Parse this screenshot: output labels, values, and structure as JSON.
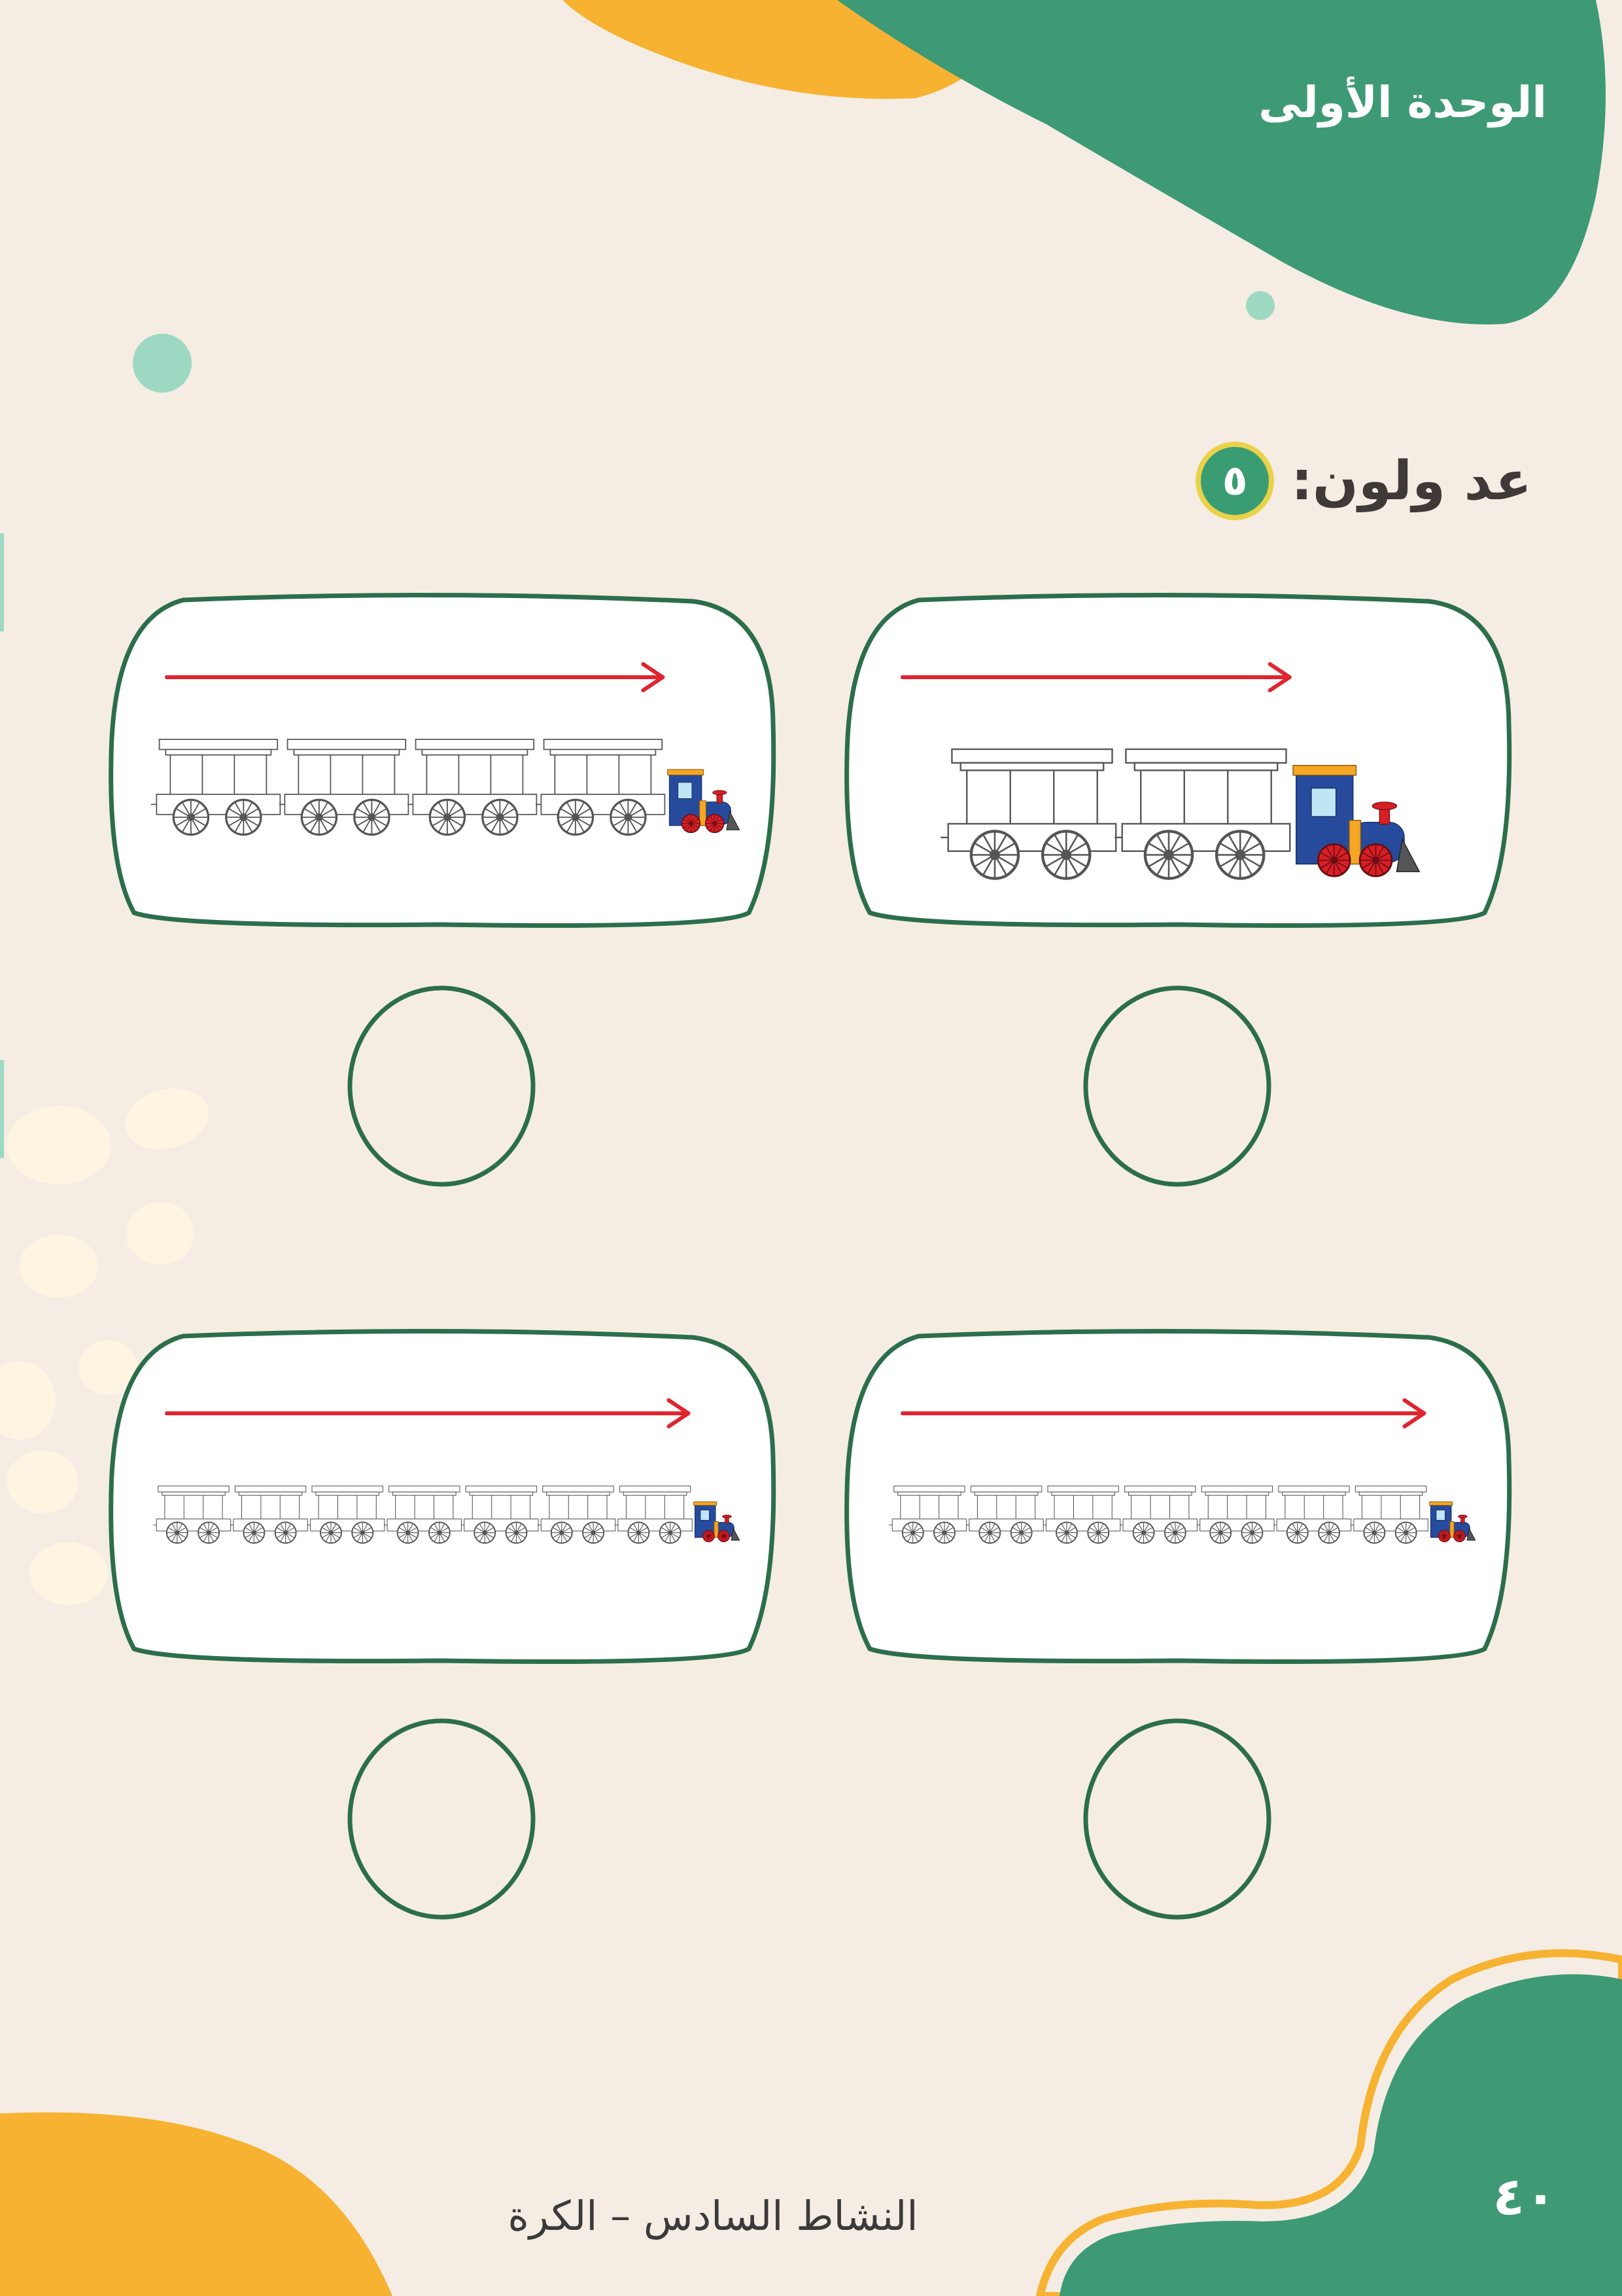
{
  "header": {
    "unit_title": "الوحدة الأولى"
  },
  "question": {
    "number": "٥",
    "instruction": "عد ولون:"
  },
  "exercises": [
    {
      "wagons": 2,
      "answer": ""
    },
    {
      "wagons": 4,
      "answer": ""
    },
    {
      "wagons": 7,
      "answer": ""
    },
    {
      "wagons": 7,
      "answer": ""
    }
  ],
  "footer": {
    "activity_title": "النشاط السادس – الكرة",
    "page_number": "٤٠"
  },
  "colors": {
    "background": "#f5ede3",
    "green": "#3d9a75",
    "orange": "#f7b232",
    "mint": "#9dd9c2",
    "card_border": "#2c6e4c",
    "arrow": "#e02530",
    "engine_blue": "#264b9c",
    "wheel_red": "#d81f26"
  },
  "icons": {
    "train": "train-icon",
    "arrow": "direction-arrow"
  }
}
